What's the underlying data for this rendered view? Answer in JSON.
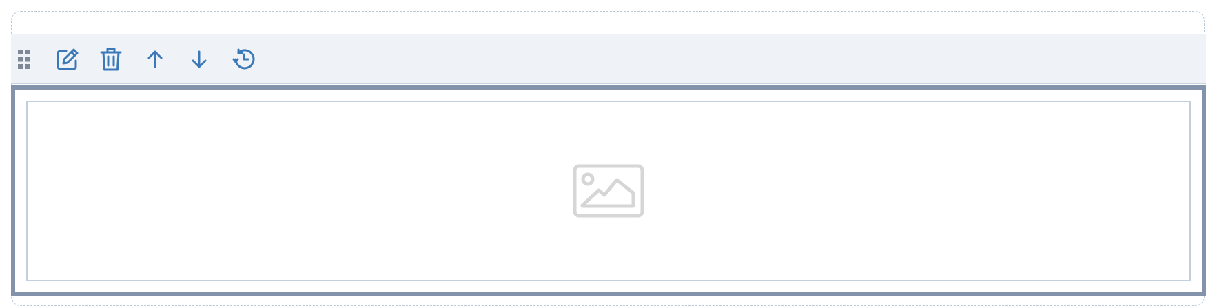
{
  "toolbar": {
    "tools": [
      {
        "name": "edit",
        "icon": "edit-icon"
      },
      {
        "name": "delete",
        "icon": "trash-icon"
      },
      {
        "name": "move-up",
        "icon": "arrow-up-icon"
      },
      {
        "name": "move-down",
        "icon": "arrow-down-icon"
      },
      {
        "name": "history",
        "icon": "history-icon"
      }
    ],
    "drag_handle_icon": "drag-handle-icon"
  },
  "content": {
    "placeholder_icon": "image-placeholder-icon"
  },
  "colors": {
    "icon_blue": "#3b78b8",
    "drag_gray": "#7f8897",
    "frame_border": "#8293ab",
    "toolbar_bg": "#eff3f7",
    "placeholder_gray": "#d6d6d6"
  }
}
